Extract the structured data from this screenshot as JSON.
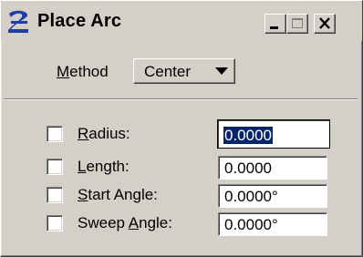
{
  "window": {
    "title": "Place Arc"
  },
  "titlebar": {
    "app_icon": "microstation-logo-icon",
    "buttons": [
      "minimize-icon",
      "maximize-icon",
      "close-icon"
    ]
  },
  "method": {
    "label": "Method",
    "selected": "Center"
  },
  "params": [
    {
      "label": "Radius:",
      "value": "0.0000",
      "checked": false,
      "selected": true
    },
    {
      "label": "Length:",
      "value": "0.0000",
      "checked": false
    },
    {
      "label": "Start Angle:",
      "value": "0.0000°",
      "checked": false
    },
    {
      "label": "Sweep Angle:",
      "value": "0.0000°",
      "checked": false
    }
  ],
  "colors": {
    "face": "#d4d0c8",
    "selection": "#0a246a",
    "logo": "#1f3fa5"
  }
}
